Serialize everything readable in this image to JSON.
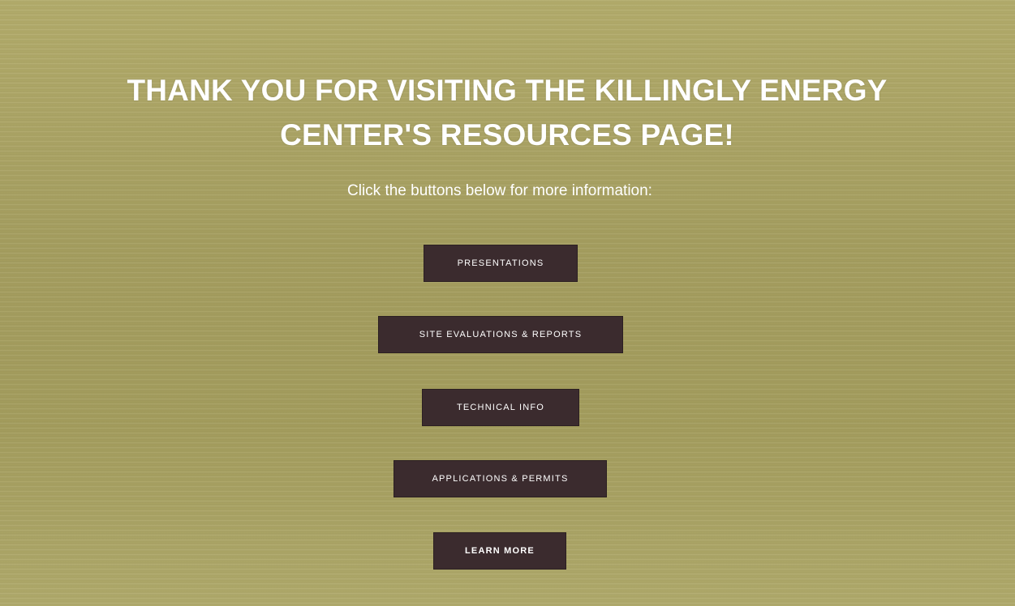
{
  "hero": {
    "title": "THANK YOU FOR VISITING THE KILLINGLY ENERGY CENTER'S RESOURCES PAGE!",
    "subtitle": "Click the buttons below for more information:"
  },
  "buttons": [
    {
      "label": "PRESENTATIONS"
    },
    {
      "label": "SITE EVALUATIONS & REPORTS"
    },
    {
      "label": "TECHNICAL INFO"
    },
    {
      "label": "APPLICATIONS & PERMITS"
    },
    {
      "label": "LEARN MORE"
    }
  ],
  "colors": {
    "background": "#a9a263",
    "button": "#3b2b2e",
    "text": "#ffffff"
  }
}
